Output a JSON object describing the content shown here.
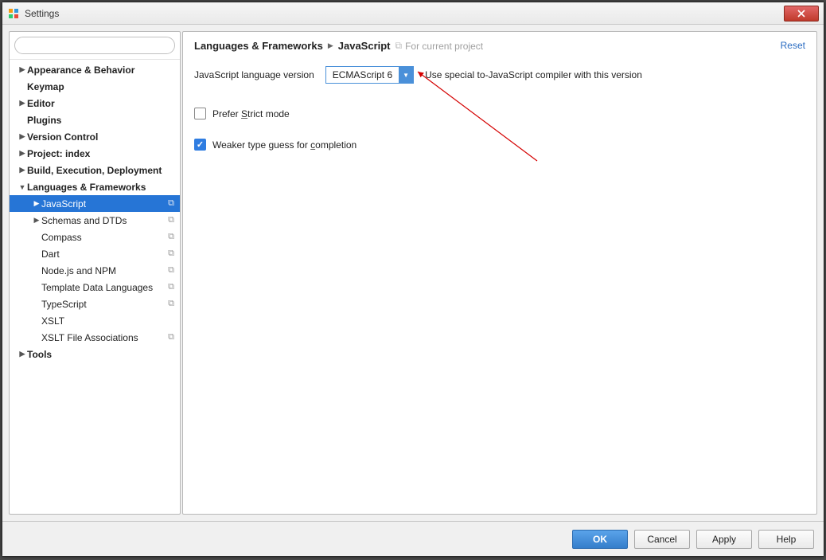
{
  "window": {
    "title": "Settings"
  },
  "sidebar": {
    "search_placeholder": "",
    "items": [
      {
        "label": "Appearance & Behavior",
        "depth": 0,
        "arrow": "right",
        "bold": true,
        "badge": false
      },
      {
        "label": "Keymap",
        "depth": 0,
        "arrow": "none",
        "bold": true,
        "badge": false
      },
      {
        "label": "Editor",
        "depth": 0,
        "arrow": "right",
        "bold": true,
        "badge": false
      },
      {
        "label": "Plugins",
        "depth": 0,
        "arrow": "none",
        "bold": true,
        "badge": false
      },
      {
        "label": "Version Control",
        "depth": 0,
        "arrow": "right",
        "bold": true,
        "badge": false
      },
      {
        "label": "Project: index",
        "depth": 0,
        "arrow": "right",
        "bold": true,
        "badge": false
      },
      {
        "label": "Build, Execution, Deployment",
        "depth": 0,
        "arrow": "right",
        "bold": true,
        "badge": false
      },
      {
        "label": "Languages & Frameworks",
        "depth": 0,
        "arrow": "down",
        "bold": true,
        "badge": false
      },
      {
        "label": "JavaScript",
        "depth": 1,
        "arrow": "right",
        "bold": false,
        "badge": true,
        "selected": true
      },
      {
        "label": "Schemas and DTDs",
        "depth": 1,
        "arrow": "right",
        "bold": false,
        "badge": true
      },
      {
        "label": "Compass",
        "depth": 1,
        "arrow": "none",
        "bold": false,
        "badge": true
      },
      {
        "label": "Dart",
        "depth": 1,
        "arrow": "none",
        "bold": false,
        "badge": true
      },
      {
        "label": "Node.js and NPM",
        "depth": 1,
        "arrow": "none",
        "bold": false,
        "badge": true
      },
      {
        "label": "Template Data Languages",
        "depth": 1,
        "arrow": "none",
        "bold": false,
        "badge": true
      },
      {
        "label": "TypeScript",
        "depth": 1,
        "arrow": "none",
        "bold": false,
        "badge": true
      },
      {
        "label": "XSLT",
        "depth": 1,
        "arrow": "none",
        "bold": false,
        "badge": false
      },
      {
        "label": "XSLT File Associations",
        "depth": 1,
        "arrow": "none",
        "bold": false,
        "badge": true
      },
      {
        "label": "Tools",
        "depth": 0,
        "arrow": "right",
        "bold": true,
        "badge": false
      }
    ]
  },
  "breadcrumb": {
    "parent": "Languages & Frameworks",
    "current": "JavaScript",
    "hint": "For current project"
  },
  "main": {
    "reset": "Reset",
    "lang_version_label": "JavaScript language version",
    "lang_version_value": "ECMAScript 6",
    "compiler_hint": "Use special to-JavaScript compiler with this version",
    "checkbox1_prefix": "Prefer ",
    "checkbox1_u": "S",
    "checkbox1_suffix": "trict mode",
    "checkbox2_prefix": "Weaker type guess for ",
    "checkbox2_u": "c",
    "checkbox2_suffix": "ompletion"
  },
  "footer": {
    "ok": "OK",
    "cancel": "Cancel",
    "apply": "Apply",
    "help": "Help"
  }
}
